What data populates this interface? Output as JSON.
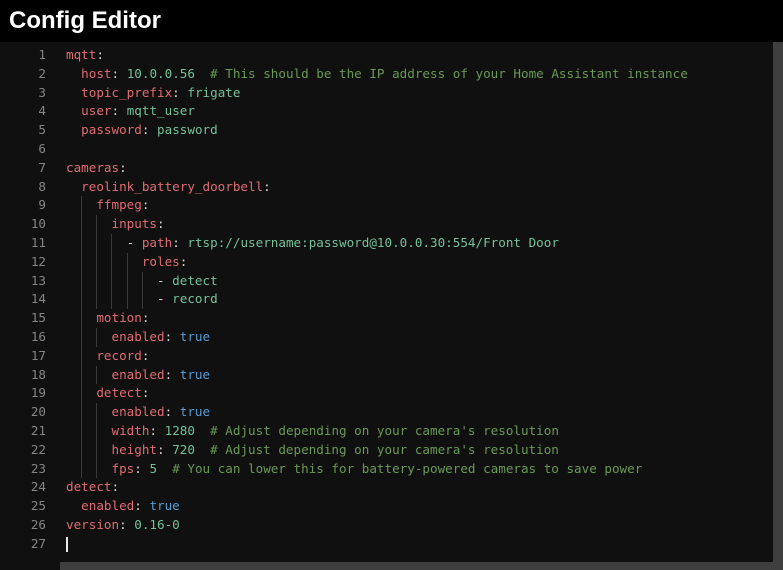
{
  "header": {
    "title": "Config Editor"
  },
  "editor": {
    "language": "yaml",
    "total_lines": 27,
    "cursor_line": 27,
    "colors": {
      "pageBackground": "#000000",
      "editorBackground": "#101010",
      "key": "#e06c75",
      "value": "#74c19a",
      "boolean": "#569cd6",
      "comment": "#6a9955",
      "punct": "#d4d4d4",
      "lineNumber": "#858585",
      "indentGuide": "#3a3a3a",
      "cursor": "#e8e8e8",
      "scrollbar": "#3f3f3f"
    },
    "lines": [
      {
        "n": 1,
        "tokens": [
          {
            "t": "key",
            "v": "mqtt"
          },
          {
            "t": "punct",
            "v": ":"
          }
        ]
      },
      {
        "n": 2,
        "tokens": [
          {
            "t": "ws",
            "v": "  "
          },
          {
            "t": "key",
            "v": "host"
          },
          {
            "t": "punct",
            "v": ":"
          },
          {
            "t": "ws",
            "v": " "
          },
          {
            "t": "val",
            "v": "10.0.0.56"
          },
          {
            "t": "ws",
            "v": "  "
          },
          {
            "t": "comment",
            "v": "# This should be the IP address of your Home Assistant instance"
          }
        ]
      },
      {
        "n": 3,
        "tokens": [
          {
            "t": "ws",
            "v": "  "
          },
          {
            "t": "key",
            "v": "topic_prefix"
          },
          {
            "t": "punct",
            "v": ":"
          },
          {
            "t": "ws",
            "v": " "
          },
          {
            "t": "val",
            "v": "frigate"
          }
        ]
      },
      {
        "n": 4,
        "tokens": [
          {
            "t": "ws",
            "v": "  "
          },
          {
            "t": "key",
            "v": "user"
          },
          {
            "t": "punct",
            "v": ":"
          },
          {
            "t": "ws",
            "v": " "
          },
          {
            "t": "val",
            "v": "mqtt_user"
          }
        ]
      },
      {
        "n": 5,
        "tokens": [
          {
            "t": "ws",
            "v": "  "
          },
          {
            "t": "key",
            "v": "password"
          },
          {
            "t": "punct",
            "v": ":"
          },
          {
            "t": "ws",
            "v": " "
          },
          {
            "t": "val",
            "v": "password"
          }
        ]
      },
      {
        "n": 6,
        "tokens": []
      },
      {
        "n": 7,
        "tokens": [
          {
            "t": "key",
            "v": "cameras"
          },
          {
            "t": "punct",
            "v": ":"
          }
        ]
      },
      {
        "n": 8,
        "tokens": [
          {
            "t": "ws",
            "v": "  "
          },
          {
            "t": "key",
            "v": "reolink_battery_doorbell"
          },
          {
            "t": "punct",
            "v": ":"
          }
        ]
      },
      {
        "n": 9,
        "tokens": [
          {
            "t": "ws",
            "v": "    "
          },
          {
            "t": "key",
            "v": "ffmpeg"
          },
          {
            "t": "punct",
            "v": ":"
          }
        ]
      },
      {
        "n": 10,
        "tokens": [
          {
            "t": "ws",
            "v": "      "
          },
          {
            "t": "key",
            "v": "inputs"
          },
          {
            "t": "punct",
            "v": ":"
          }
        ]
      },
      {
        "n": 11,
        "tokens": [
          {
            "t": "ws",
            "v": "        "
          },
          {
            "t": "punct",
            "v": "- "
          },
          {
            "t": "key",
            "v": "path"
          },
          {
            "t": "punct",
            "v": ":"
          },
          {
            "t": "ws",
            "v": " "
          },
          {
            "t": "val",
            "v": "rtsp://username:password@10.0.0.30:554/Front Door"
          }
        ]
      },
      {
        "n": 12,
        "tokens": [
          {
            "t": "ws",
            "v": "          "
          },
          {
            "t": "key",
            "v": "roles"
          },
          {
            "t": "punct",
            "v": ":"
          }
        ]
      },
      {
        "n": 13,
        "tokens": [
          {
            "t": "ws",
            "v": "            "
          },
          {
            "t": "punct",
            "v": "- "
          },
          {
            "t": "val",
            "v": "detect"
          }
        ]
      },
      {
        "n": 14,
        "tokens": [
          {
            "t": "ws",
            "v": "            "
          },
          {
            "t": "punct",
            "v": "- "
          },
          {
            "t": "val",
            "v": "record"
          }
        ]
      },
      {
        "n": 15,
        "tokens": [
          {
            "t": "ws",
            "v": "    "
          },
          {
            "t": "key",
            "v": "motion"
          },
          {
            "t": "punct",
            "v": ":"
          }
        ]
      },
      {
        "n": 16,
        "tokens": [
          {
            "t": "ws",
            "v": "      "
          },
          {
            "t": "key",
            "v": "enabled"
          },
          {
            "t": "punct",
            "v": ":"
          },
          {
            "t": "ws",
            "v": " "
          },
          {
            "t": "bool",
            "v": "true"
          }
        ]
      },
      {
        "n": 17,
        "tokens": [
          {
            "t": "ws",
            "v": "    "
          },
          {
            "t": "key",
            "v": "record"
          },
          {
            "t": "punct",
            "v": ":"
          }
        ]
      },
      {
        "n": 18,
        "tokens": [
          {
            "t": "ws",
            "v": "      "
          },
          {
            "t": "key",
            "v": "enabled"
          },
          {
            "t": "punct",
            "v": ":"
          },
          {
            "t": "ws",
            "v": " "
          },
          {
            "t": "bool",
            "v": "true"
          }
        ]
      },
      {
        "n": 19,
        "tokens": [
          {
            "t": "ws",
            "v": "    "
          },
          {
            "t": "key",
            "v": "detect"
          },
          {
            "t": "punct",
            "v": ":"
          }
        ]
      },
      {
        "n": 20,
        "tokens": [
          {
            "t": "ws",
            "v": "      "
          },
          {
            "t": "key",
            "v": "enabled"
          },
          {
            "t": "punct",
            "v": ":"
          },
          {
            "t": "ws",
            "v": " "
          },
          {
            "t": "bool",
            "v": "true"
          }
        ]
      },
      {
        "n": 21,
        "tokens": [
          {
            "t": "ws",
            "v": "      "
          },
          {
            "t": "key",
            "v": "width"
          },
          {
            "t": "punct",
            "v": ":"
          },
          {
            "t": "ws",
            "v": " "
          },
          {
            "t": "val",
            "v": "1280"
          },
          {
            "t": "ws",
            "v": "  "
          },
          {
            "t": "comment",
            "v": "# Adjust depending on your camera's resolution"
          }
        ]
      },
      {
        "n": 22,
        "tokens": [
          {
            "t": "ws",
            "v": "      "
          },
          {
            "t": "key",
            "v": "height"
          },
          {
            "t": "punct",
            "v": ":"
          },
          {
            "t": "ws",
            "v": " "
          },
          {
            "t": "val",
            "v": "720"
          },
          {
            "t": "ws",
            "v": "  "
          },
          {
            "t": "comment",
            "v": "# Adjust depending on your camera's resolution"
          }
        ]
      },
      {
        "n": 23,
        "tokens": [
          {
            "t": "ws",
            "v": "      "
          },
          {
            "t": "key",
            "v": "fps"
          },
          {
            "t": "punct",
            "v": ":"
          },
          {
            "t": "ws",
            "v": " "
          },
          {
            "t": "val",
            "v": "5"
          },
          {
            "t": "ws",
            "v": "  "
          },
          {
            "t": "comment",
            "v": "# You can lower this for battery-powered cameras to save power"
          }
        ]
      },
      {
        "n": 24,
        "tokens": [
          {
            "t": "key",
            "v": "detect"
          },
          {
            "t": "punct",
            "v": ":"
          }
        ]
      },
      {
        "n": 25,
        "tokens": [
          {
            "t": "ws",
            "v": "  "
          },
          {
            "t": "key",
            "v": "enabled"
          },
          {
            "t": "punct",
            "v": ":"
          },
          {
            "t": "ws",
            "v": " "
          },
          {
            "t": "bool",
            "v": "true"
          }
        ]
      },
      {
        "n": 26,
        "tokens": [
          {
            "t": "key",
            "v": "version"
          },
          {
            "t": "punct",
            "v": ":"
          },
          {
            "t": "ws",
            "v": " "
          },
          {
            "t": "val",
            "v": "0.16-0"
          }
        ]
      },
      {
        "n": 27,
        "tokens": []
      }
    ]
  }
}
